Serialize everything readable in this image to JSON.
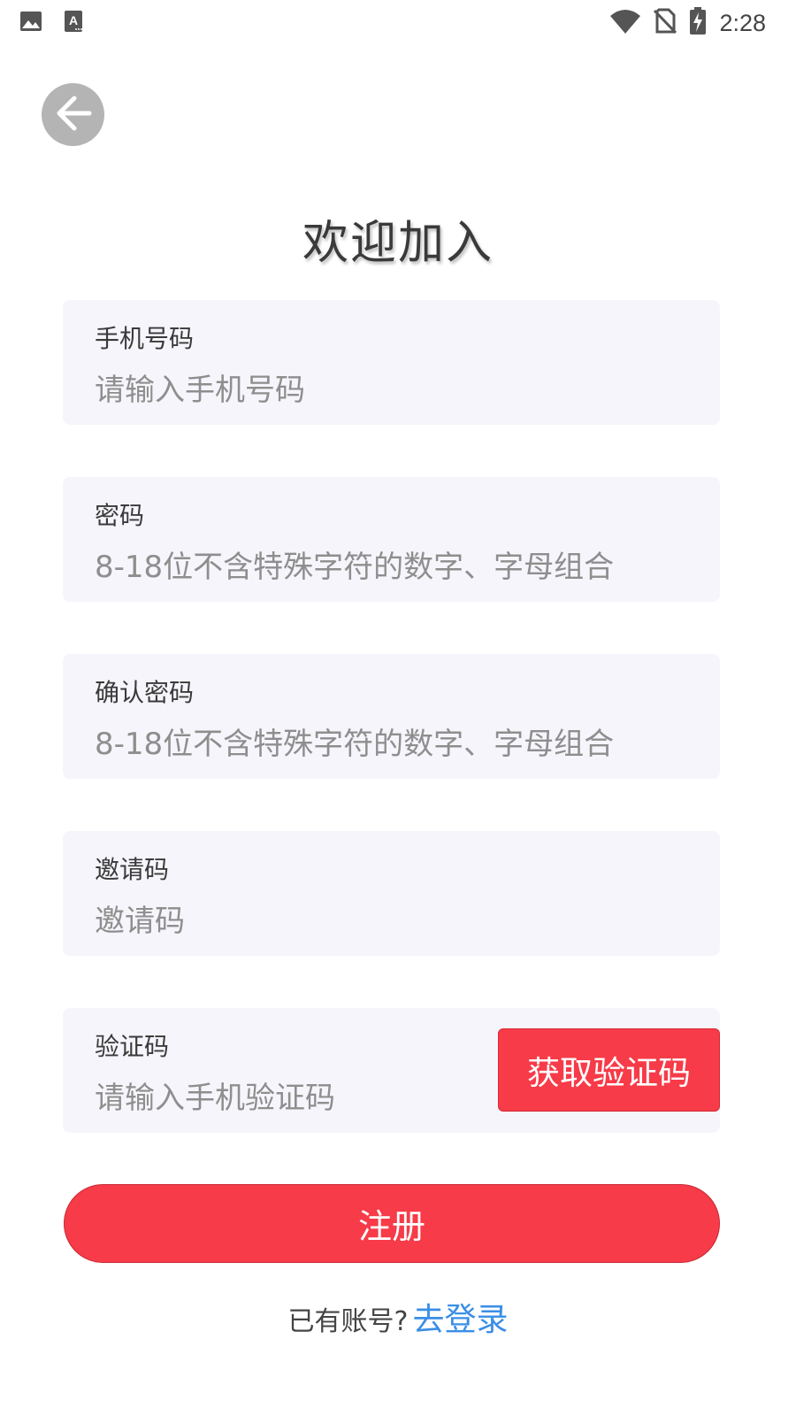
{
  "status_bar": {
    "time": "2:28",
    "left_icons": [
      "image-icon",
      "text-a-icon"
    ],
    "right_icons": [
      "wifi-icon",
      "no-sim-icon",
      "battery-charging-icon"
    ]
  },
  "title": "欢迎加入",
  "fields": {
    "phone": {
      "label": "手机号码",
      "placeholder": "请输入手机号码"
    },
    "password": {
      "label": "密码",
      "placeholder": "8-18位不含特殊字符的数字、字母组合"
    },
    "confirm_password": {
      "label": "确认密码",
      "placeholder": "8-18位不含特殊字符的数字、字母组合"
    },
    "invite_code": {
      "label": "邀请码",
      "placeholder": "邀请码"
    },
    "verify_code": {
      "label": "验证码",
      "placeholder": "请输入手机验证码",
      "button_label": "获取验证码"
    }
  },
  "register_button": "注册",
  "login": {
    "prompt": "已有账号?",
    "link": "去登录"
  },
  "colors": {
    "accent_red": "#f73b48",
    "link_blue": "#3a8ee6",
    "field_bg": "#f6f5fb",
    "back_button_bg": "#b4b4b4"
  }
}
